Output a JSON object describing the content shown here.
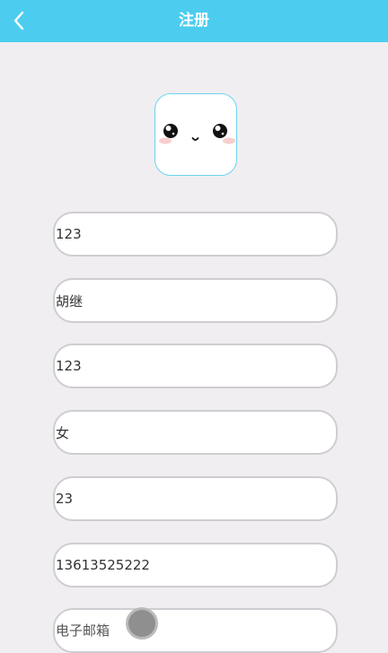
{
  "header": {
    "title": "注册",
    "back_icon": "chevron-left-icon",
    "background_color": "#4ccdf0"
  },
  "avatar": {
    "icon": "kawaii-face-avatar-icon",
    "border_color": "#6ad3ef"
  },
  "form": {
    "username": {
      "value": "123"
    },
    "real_name": {
      "value": "胡继"
    },
    "password": {
      "value": "123"
    },
    "gender": {
      "value": "女"
    },
    "age": {
      "value": "23"
    },
    "phone": {
      "value": "13613525222"
    },
    "email": {
      "value": "",
      "placeholder": "电子邮箱"
    }
  }
}
